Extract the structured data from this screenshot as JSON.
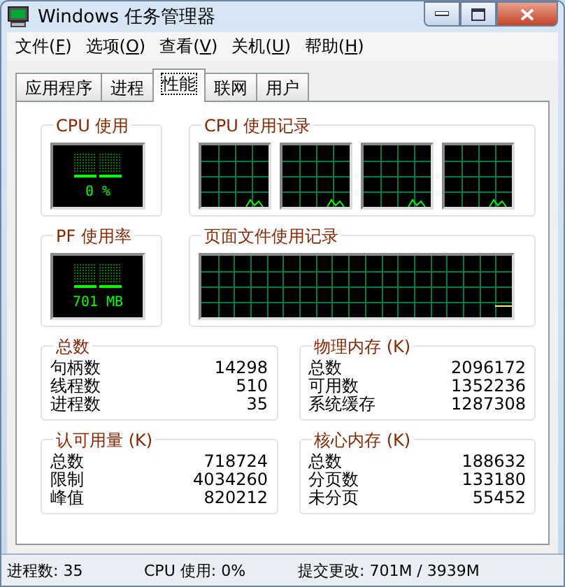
{
  "window": {
    "title": "Windows 任务管理器"
  },
  "menu": [
    {
      "label": "文件(F)"
    },
    {
      "label": "选项(O)"
    },
    {
      "label": "查看(V)"
    },
    {
      "label": "关机(U)"
    },
    {
      "label": "帮助(H)"
    }
  ],
  "tabs": [
    {
      "label": "应用程序",
      "selected": false
    },
    {
      "label": "进程",
      "selected": false
    },
    {
      "label": "性能",
      "selected": true
    },
    {
      "label": "联网",
      "selected": false
    },
    {
      "label": "用户",
      "selected": false
    }
  ],
  "meters": [
    {
      "title": "CPU 使用",
      "reading": "0 %",
      "history_title": "CPU 使用记录",
      "kind": "cpu"
    },
    {
      "title": "PF 使用率",
      "reading": "701 MB",
      "history_title": "页面文件使用记录",
      "kind": "pagefile"
    }
  ],
  "stats": [
    {
      "title": "总数",
      "rows": [
        [
          "句柄数",
          "14298"
        ],
        [
          "线程数",
          "510"
        ],
        [
          "进程数",
          "35"
        ]
      ]
    },
    {
      "title": "物理内存 (K)",
      "rows": [
        [
          "总数",
          "2096172"
        ],
        [
          "可用数",
          "1352236"
        ],
        [
          "系统缓存",
          "1287308"
        ]
      ]
    },
    {
      "title": "认可用量 (K)",
      "rows": [
        [
          "总数",
          "718724"
        ],
        [
          "限制",
          "4034260"
        ],
        [
          "峰值",
          "820212"
        ]
      ]
    },
    {
      "title": "核心内存 (K)",
      "rows": [
        [
          "总数",
          "188632"
        ],
        [
          "分页数",
          "133180"
        ],
        [
          "未分页",
          "55452"
        ]
      ]
    }
  ],
  "status_bar": [
    "进程数: 35",
    "CPU 使用: 0%",
    "提交更改: 701M / 3939M"
  ]
}
